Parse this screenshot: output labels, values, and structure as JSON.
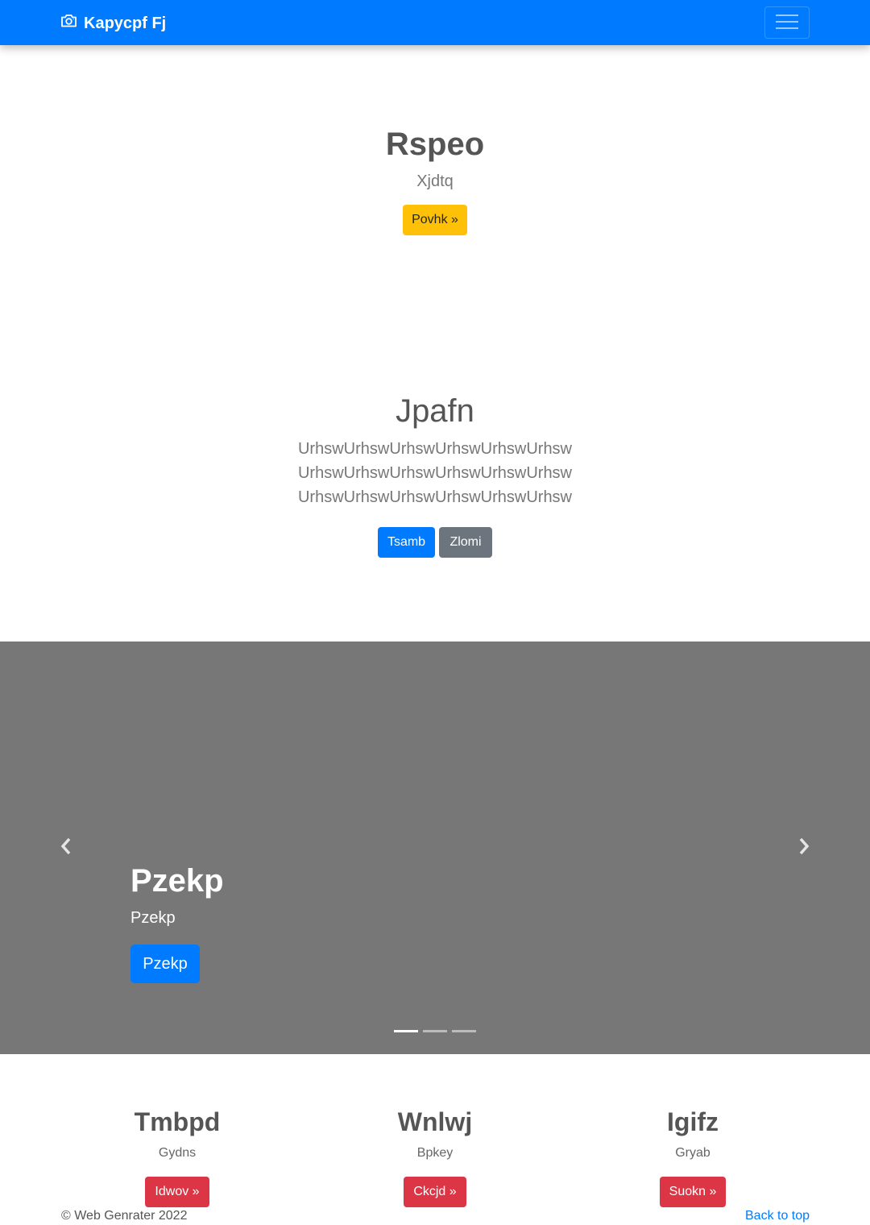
{
  "navbar": {
    "brand": "Kapycpf Fj",
    "brand_icon": "camera-icon",
    "toggler_icon": "hamburger-menu-icon"
  },
  "hero1": {
    "title": "Rspeo",
    "subtitle": "Xjdtq",
    "button": "Povhk »"
  },
  "hero2": {
    "title": "Jpafn",
    "lines": [
      "UrhswUrhswUrhswUrhswUrhswUrhsw",
      "UrhswUrhswUrhswUrhswUrhswUrhsw",
      "UrhswUrhswUrhswUrhswUrhswUrhsw"
    ],
    "primary_button": "Tsamb",
    "secondary_button": "Zlomi"
  },
  "carousel": {
    "title": "Pzekp",
    "text": "Pzekp",
    "button": "Pzekp",
    "prev_icon": "chevron-left-icon",
    "next_icon": "chevron-right-icon",
    "indicator_count": 3,
    "active_index": 0,
    "background": "#777777"
  },
  "features": [
    {
      "title": "Tmbpd",
      "text": "Gydns",
      "button": "Idwov »"
    },
    {
      "title": "Wnlwj",
      "text": "Bpkey",
      "button": "Ckcjd »"
    },
    {
      "title": "Igifz",
      "text": "Gryab",
      "button": "Suokn »"
    }
  ],
  "footer": {
    "copyright": "© Web Genrater 2022",
    "back_to_top": "Back to top"
  },
  "colors": {
    "primary": "#007bff",
    "warning": "#ffc107",
    "secondary": "#6c757d",
    "danger": "#dc3545"
  }
}
